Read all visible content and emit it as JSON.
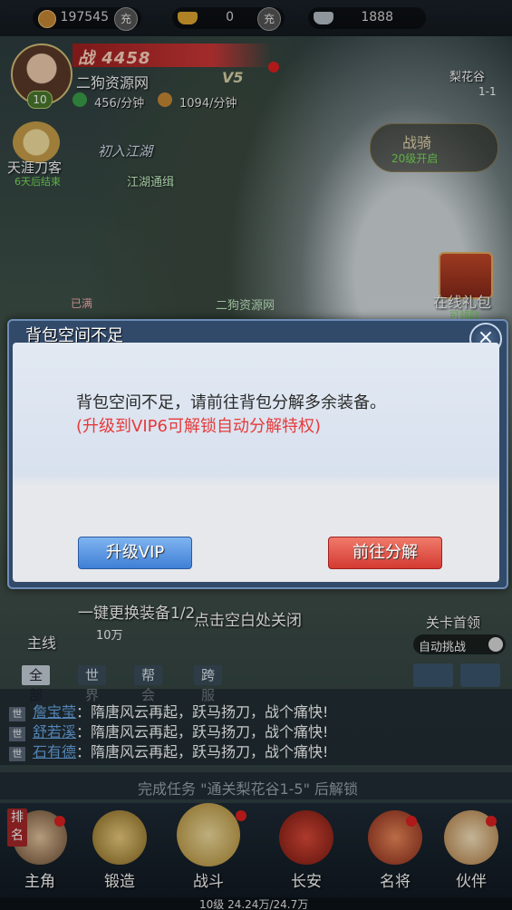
{
  "resources": [
    {
      "value": "197545",
      "icon": "copper-coin-icon",
      "recharge": "充"
    },
    {
      "value": "0",
      "icon": "gold-ingot-icon",
      "recharge": "充"
    },
    {
      "value": "1888",
      "icon": "silver-ingot-icon",
      "recharge": ""
    }
  ],
  "player": {
    "power_label": "战 4458",
    "name": "二狗资源网",
    "vip": "V5",
    "level": "10",
    "exp_rate": "456/分钟",
    "copper_rate": "1094/分钟"
  },
  "left": {
    "wanderer_title": "天涯刀客",
    "wanderer_sub": "6天后结束",
    "quest_banner": "初入江湖",
    "jianghu_label": "江湖通缉"
  },
  "right": {
    "map_name": "梨花谷",
    "map_stage": "1-1",
    "mount_title": "战骑",
    "mount_sub": "20级开启",
    "gift_title": "在线礼包",
    "gift_sub": "可领取"
  },
  "scene": {
    "npc_name": "二狗资源网",
    "full_label": "已满"
  },
  "dialog": {
    "title": "背包空间不足",
    "line1": "背包空间不足，请前往背包分解多余装备。",
    "line2": "(升级到VIP6可解锁自动分解特权)",
    "vip_button": "升级VIP",
    "decompose_button": "前往分解",
    "close": "×"
  },
  "below": {
    "onekey": "一键更换装备1/2",
    "onekey_value": "10万",
    "main_quest": "主线",
    "close_hint": "点击空白处关闭",
    "boss_label": "关卡首领",
    "auto_challenge": "自动挑战"
  },
  "chat": {
    "tabs": [
      "全部",
      "世界",
      "帮会",
      "跨服"
    ],
    "active_tab": 0,
    "messages": [
      {
        "channel": "世",
        "name": "詹宝莹",
        "text": "：隋唐风云再起，跃马扬刀，战个痛快!"
      },
      {
        "channel": "世",
        "name": "舒若溪",
        "text": "：隋唐风云再起，跃马扬刀，战个痛快!"
      },
      {
        "channel": "世",
        "name": "石有德",
        "text": "：隋唐风云再起，跃马扬刀，战个痛快!"
      }
    ]
  },
  "unlock_text": "完成任务 \"通关梨花谷1-5\" 后解锁",
  "nav": [
    {
      "label": "主角",
      "icon": "hero-icon"
    },
    {
      "label": "锻造",
      "icon": "forge-icon"
    },
    {
      "label": "战斗",
      "icon": "crossed-swords-icon"
    },
    {
      "label": "长安",
      "icon": "palace-icon"
    },
    {
      "label": "名将",
      "icon": "general-icon"
    },
    {
      "label": "伙伴",
      "icon": "partner-icon"
    }
  ],
  "rank_badge": "排名",
  "xp_text": "10级 24.24万/24.7万",
  "colors": {
    "accent_red": "#d43a32",
    "accent_blue": "#3f7fd6",
    "green_text": "#7ae05a"
  }
}
